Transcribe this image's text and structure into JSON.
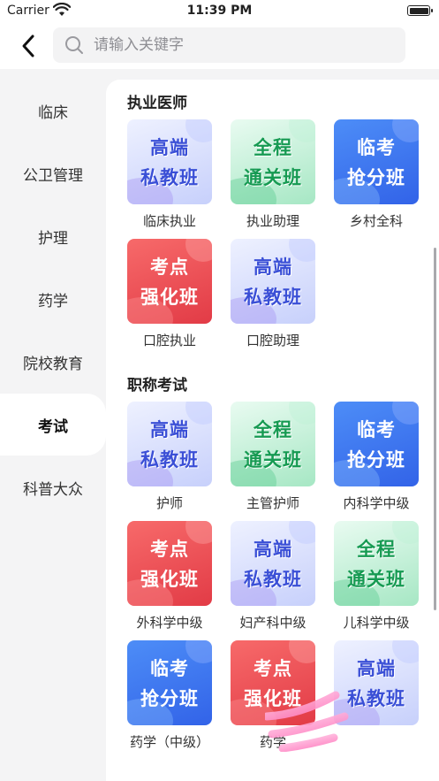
{
  "status": {
    "carrier": "Carrier",
    "time": "11:39 PM"
  },
  "search": {
    "placeholder": "请输入关键字"
  },
  "sidebar": {
    "items": [
      {
        "label": "临床"
      },
      {
        "label": "公卫管理"
      },
      {
        "label": "护理"
      },
      {
        "label": "药学"
      },
      {
        "label": "院校教育"
      },
      {
        "label": "考试",
        "active": true
      },
      {
        "label": "科普大众"
      }
    ]
  },
  "sections": [
    {
      "title": "执业医师",
      "items": [
        {
          "label": "临床执业",
          "badge": [
            "高端",
            "私教班"
          ],
          "theme": "gaoduan"
        },
        {
          "label": "执业助理",
          "badge": [
            "全程",
            "通关班"
          ],
          "theme": "quancheng"
        },
        {
          "label": "乡村全科",
          "badge": [
            "临考",
            "抢分班"
          ],
          "theme": "linkao"
        },
        {
          "label": "口腔执业",
          "badge": [
            "考点",
            "强化班"
          ],
          "theme": "kaodian"
        },
        {
          "label": "口腔助理",
          "badge": [
            "高端",
            "私教班"
          ],
          "theme": "gaoduan"
        }
      ]
    },
    {
      "title": "职称考试",
      "items": [
        {
          "label": "护师",
          "badge": [
            "高端",
            "私教班"
          ],
          "theme": "gaoduan"
        },
        {
          "label": "主管护师",
          "badge": [
            "全程",
            "通关班"
          ],
          "theme": "quancheng"
        },
        {
          "label": "内科学中级",
          "badge": [
            "临考",
            "抢分班"
          ],
          "theme": "linkao"
        },
        {
          "label": "外科学中级",
          "badge": [
            "考点",
            "强化班"
          ],
          "theme": "kaodian"
        },
        {
          "label": "妇产科中级",
          "badge": [
            "高端",
            "私教班"
          ],
          "theme": "gaoduan"
        },
        {
          "label": "儿科学中级",
          "badge": [
            "全程",
            "通关班"
          ],
          "theme": "quancheng"
        },
        {
          "label": "药学（中级）",
          "badge": [
            "临考",
            "抢分班"
          ],
          "theme": "linkao"
        },
        {
          "label": "药学",
          "badge": [
            "考点",
            "强化班"
          ],
          "theme": "kaodian"
        },
        {
          "label": "",
          "badge": [
            "高端",
            "私教班"
          ],
          "theme": "gaoduan"
        }
      ]
    }
  ],
  "icons": {
    "back": "chevron-left-icon",
    "search": "search-icon",
    "wifi": "wifi-icon",
    "battery": "battery-icon"
  }
}
